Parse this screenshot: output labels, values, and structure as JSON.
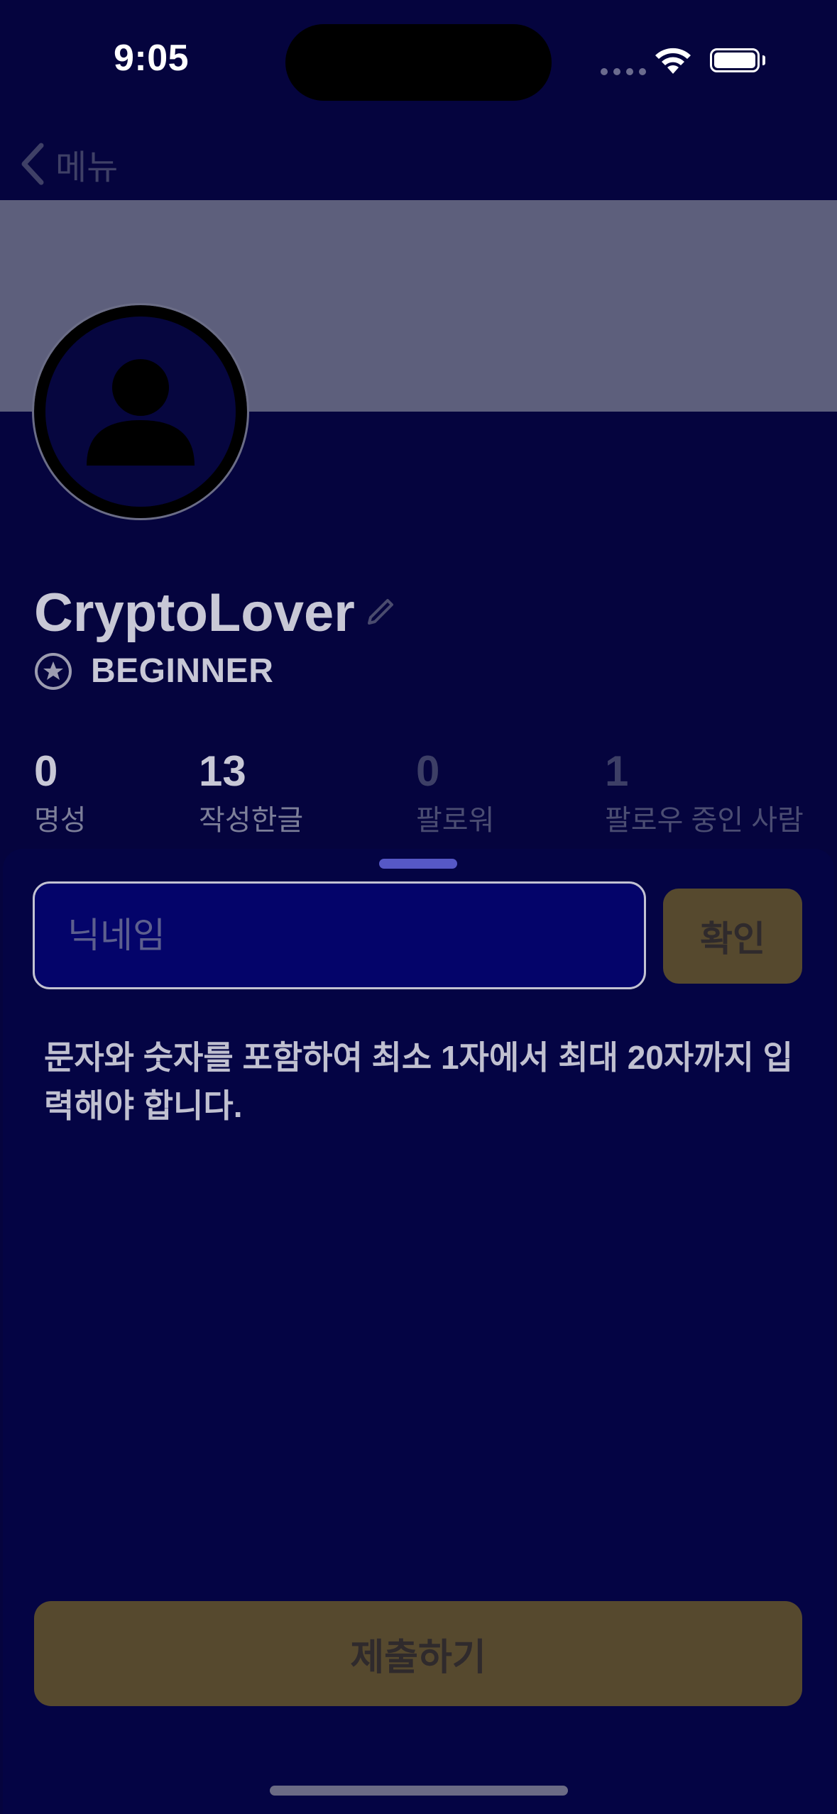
{
  "status_bar": {
    "time": "9:05"
  },
  "nav": {
    "back_label": "메뉴"
  },
  "profile": {
    "username": "CryptoLover",
    "rank": "BEGINNER",
    "stats": [
      {
        "value": "0",
        "label": "명성"
      },
      {
        "value": "13",
        "label": "작성한글"
      },
      {
        "value": "0",
        "label": "팔로워"
      },
      {
        "value": "1",
        "label": "팔로우 중인 사람"
      }
    ]
  },
  "sheet": {
    "nickname_placeholder": "닉네임",
    "confirm_label": "확인",
    "helper_text": "문자와 숫자를 포함하여 최소 1자에서 최대 20자까지 입력해야 합니다.",
    "submit_label": "제출하기"
  },
  "colors": {
    "background": "#05043e",
    "banner": "#5d5f7c",
    "button_disabled": "#56492e",
    "grabber": "#5658c6"
  }
}
